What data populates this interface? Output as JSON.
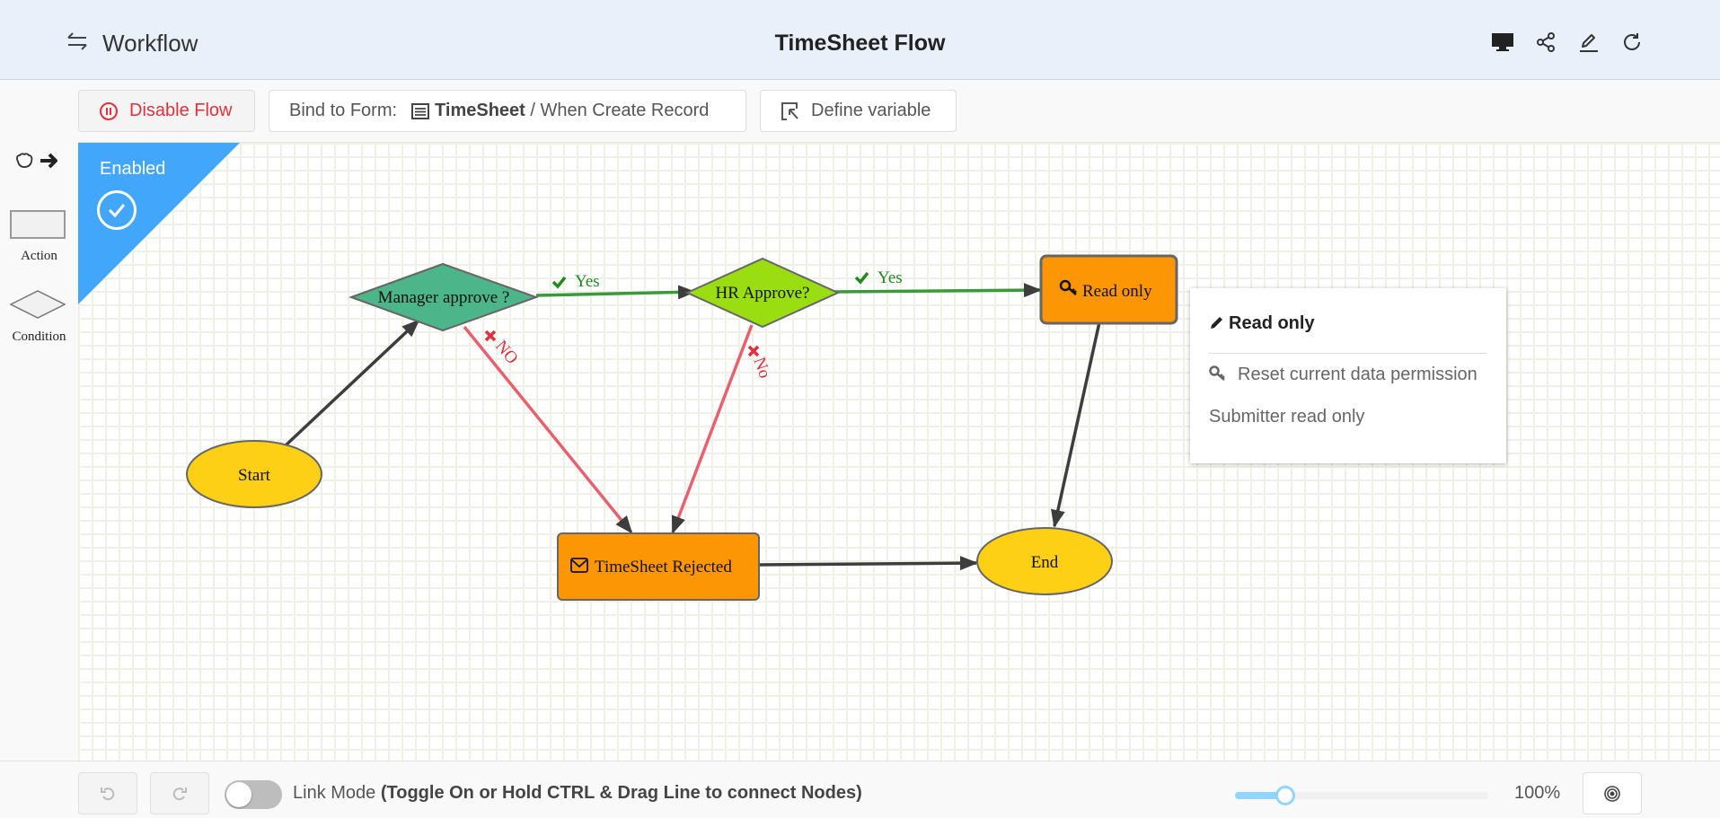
{
  "header": {
    "back_icon": "exchange-arrows-icon",
    "app_title": "Workflow",
    "page_title": "TimeSheet Flow",
    "actions": [
      {
        "name": "preview-button",
        "icon": "monitor-icon"
      },
      {
        "name": "share-button",
        "icon": "share-icon"
      },
      {
        "name": "edit-button",
        "icon": "pencil-icon"
      },
      {
        "name": "refresh-button",
        "icon": "refresh-icon"
      }
    ]
  },
  "toolbar": {
    "disable_label": "Disable Flow",
    "bind_prefix": "Bind to Form:",
    "bind_form": "TimeSheet",
    "bind_event": " / When Create Record",
    "define_label": "Define variable"
  },
  "palette": {
    "action_label": "Action",
    "condition_label": "Condition"
  },
  "status": {
    "label": "Enabled",
    "color": "#42a6fb"
  },
  "nodes": {
    "start": {
      "label": "Start",
      "type": "ellipse",
      "color": "#fdd015"
    },
    "manager": {
      "label": "Manager approve ?",
      "type": "condition",
      "color": "#4cb58a"
    },
    "hr": {
      "label": "HR Approve?",
      "type": "condition",
      "color": "#9ade12"
    },
    "readonly": {
      "label": "Read only",
      "type": "action",
      "icon": "key-icon",
      "color": "#fd9604"
    },
    "rejected": {
      "label": "TimeSheet Rejected",
      "type": "action",
      "icon": "envelope-icon",
      "color": "#fd9604"
    },
    "end": {
      "label": "End",
      "type": "ellipse",
      "color": "#fdd015"
    }
  },
  "edges": {
    "yes1": "Yes",
    "yes2": "Yes",
    "no1": "NO",
    "no2": "No",
    "yes_color": "#3a9a3a",
    "no_color": "#e8606e"
  },
  "popup": {
    "title": "Read only",
    "items": [
      "Reset current data permission",
      "Submitter read only"
    ]
  },
  "footer": {
    "link_mode_label": "Link Mode ",
    "link_mode_hint": "(Toggle On or Hold CTRL & Drag Line to connect Nodes)",
    "link_mode_on": false,
    "zoom_fraction": 0.2,
    "zoom_label": "100%"
  }
}
